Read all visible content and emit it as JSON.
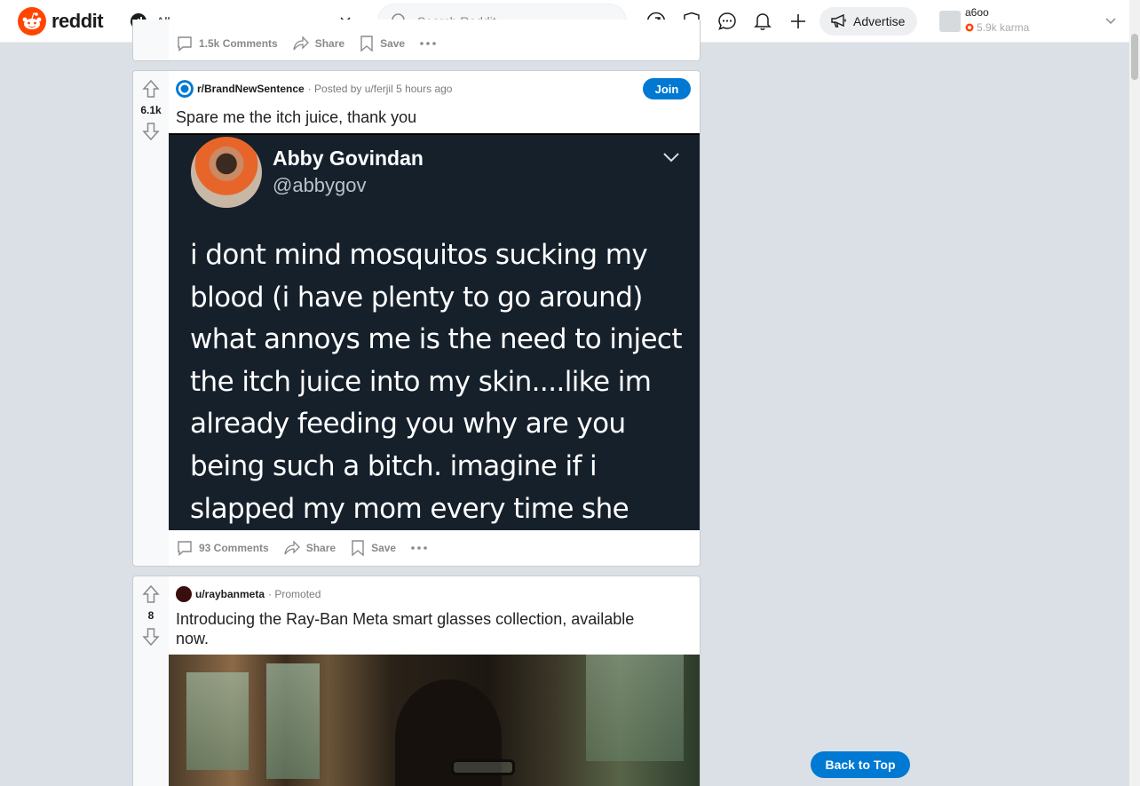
{
  "header": {
    "logo_text": "reddit",
    "feed_label": "All",
    "search_placeholder": "Search Reddit",
    "advertise_label": "Advertise",
    "user": {
      "name": "a6oo",
      "karma": "5.9k karma"
    }
  },
  "prev_post": {
    "comments": "1.5k Comments",
    "share": "Share",
    "save": "Save"
  },
  "post1": {
    "votes": "6.1k",
    "subreddit": "r/BrandNewSentence",
    "posted_by": "· Posted by u/ferjil 5 hours ago",
    "join_label": "Join",
    "title": "Spare me the itch juice, thank you",
    "tweet": {
      "name": "Abby Govindan",
      "handle": "@abbygov",
      "text": "i dont mind mosquitos sucking my blood (i have plenty to go around) what annoys me is the need to inject the itch juice into my skin....like im already feeding you why are you being such a bitch. imagine if i slapped my mom every time she made me dinner."
    },
    "comments": "93 Comments",
    "share": "Share",
    "save": "Save"
  },
  "post2": {
    "votes": "8",
    "user": "u/raybanmeta",
    "promoted": "· Promoted",
    "title": "Introducing the Ray-Ban Meta smart glasses collection, available now."
  },
  "back_to_top": "Back to Top",
  "colors": {
    "brand": "#ff4500",
    "accent": "#0079d3",
    "background": "#dae0e6"
  },
  "icons": [
    "reddit-logo-icon",
    "popular-icon",
    "chevron-down-icon",
    "search-icon",
    "trending-icon",
    "shield-icon",
    "chat-icon",
    "bell-icon",
    "plus-icon",
    "megaphone-icon",
    "upvote-icon",
    "downvote-icon",
    "comment-icon",
    "share-icon",
    "bookmark-icon",
    "more-icon"
  ]
}
